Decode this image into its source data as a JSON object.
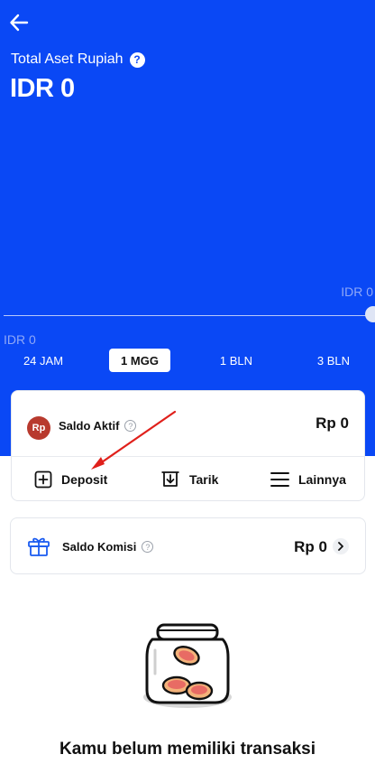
{
  "header": {
    "back_icon": "arrow-left-icon",
    "asset_label": "Total Aset Rupiah",
    "help_glyph": "?",
    "asset_value": "IDR 0"
  },
  "chart": {
    "max_label": "IDR 0",
    "min_label": "IDR 0"
  },
  "ranges": {
    "items": [
      "24 JAM",
      "1 MGG",
      "1 BLN",
      "3 BLN"
    ],
    "selected": "1 MGG"
  },
  "saldo": {
    "icon_text": "Rp",
    "label": "Saldo Aktif",
    "value": "Rp 0"
  },
  "actions": {
    "deposit": "Deposit",
    "tarik": "Tarik",
    "lainnya": "Lainnya"
  },
  "komisi": {
    "label": "Saldo Komisi",
    "value": "Rp 0"
  },
  "empty_state": {
    "message": "Kamu belum memiliki transaksi"
  },
  "colors": {
    "primary_blue": "#0a48f5",
    "annotation_red": "#e0201b",
    "rp_badge": "#b83a2e"
  }
}
